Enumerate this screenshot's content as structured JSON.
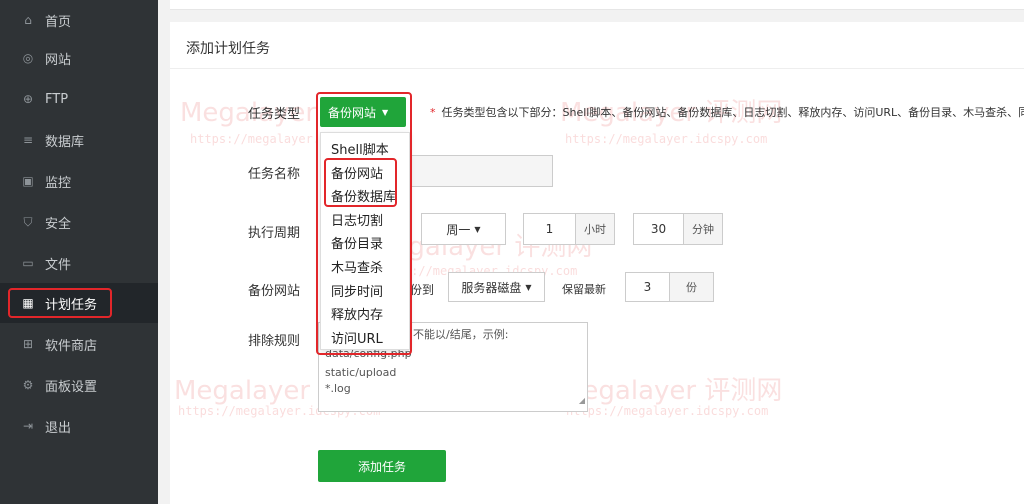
{
  "sidebar": {
    "items": [
      {
        "label": "首页",
        "icon": "home-icon"
      },
      {
        "label": "网站",
        "icon": "globe-icon"
      },
      {
        "label": "FTP",
        "icon": "ftp-icon"
      },
      {
        "label": "数据库",
        "icon": "database-icon"
      },
      {
        "label": "监控",
        "icon": "monitor-icon"
      },
      {
        "label": "安全",
        "icon": "shield-icon"
      },
      {
        "label": "文件",
        "icon": "folder-icon"
      },
      {
        "label": "计划任务",
        "icon": "calendar-icon",
        "active": true
      },
      {
        "label": "软件商店",
        "icon": "grid-icon"
      },
      {
        "label": "面板设置",
        "icon": "gear-icon"
      },
      {
        "label": "退出",
        "icon": "logout-icon"
      }
    ]
  },
  "panel": {
    "title": "添加计划任务"
  },
  "form": {
    "task_type_label": "任务类型",
    "task_type_value": "备份网站",
    "task_type_hint": "任务类型包含以下部分：Shell脚本、备份网站、备份数据库、日志切割、释放内存、访问URL、备份目录、木马查杀、同",
    "task_name_label": "任务名称",
    "cycle_label": "执行周期",
    "cycle_weekday": "周一",
    "cycle_hour_value": "1",
    "cycle_hour_unit": "小时",
    "cycle_minute_value": "30",
    "cycle_minute_unit": "分钟",
    "backup_site_label": "备份网站",
    "backup_to_suffix": "份到",
    "backup_target": "服务器磁盘",
    "keep_latest_label": "保留最新",
    "keep_value": "3",
    "keep_unit": "份",
    "exclude_label": "排除规则",
    "exclude_hint_tail": "不能以/结尾，示例:",
    "exclude_lines": [
      "data/config.php",
      "static/upload",
      "*.log"
    ],
    "submit_label": "添加任务"
  },
  "dropdown": {
    "options": [
      "Shell脚本",
      "备份网站",
      "备份数据库",
      "日志切割",
      "备份目录",
      "木马查杀",
      "同步时间",
      "释放内存",
      "访问URL"
    ]
  },
  "watermark": {
    "brand": "Megalayer 评测网",
    "url": "https://megalayer.idcspy.com"
  },
  "colors": {
    "sidebar_bg": "#2f3336",
    "accent_green": "#20a53a",
    "highlight_red": "#e2262a"
  }
}
